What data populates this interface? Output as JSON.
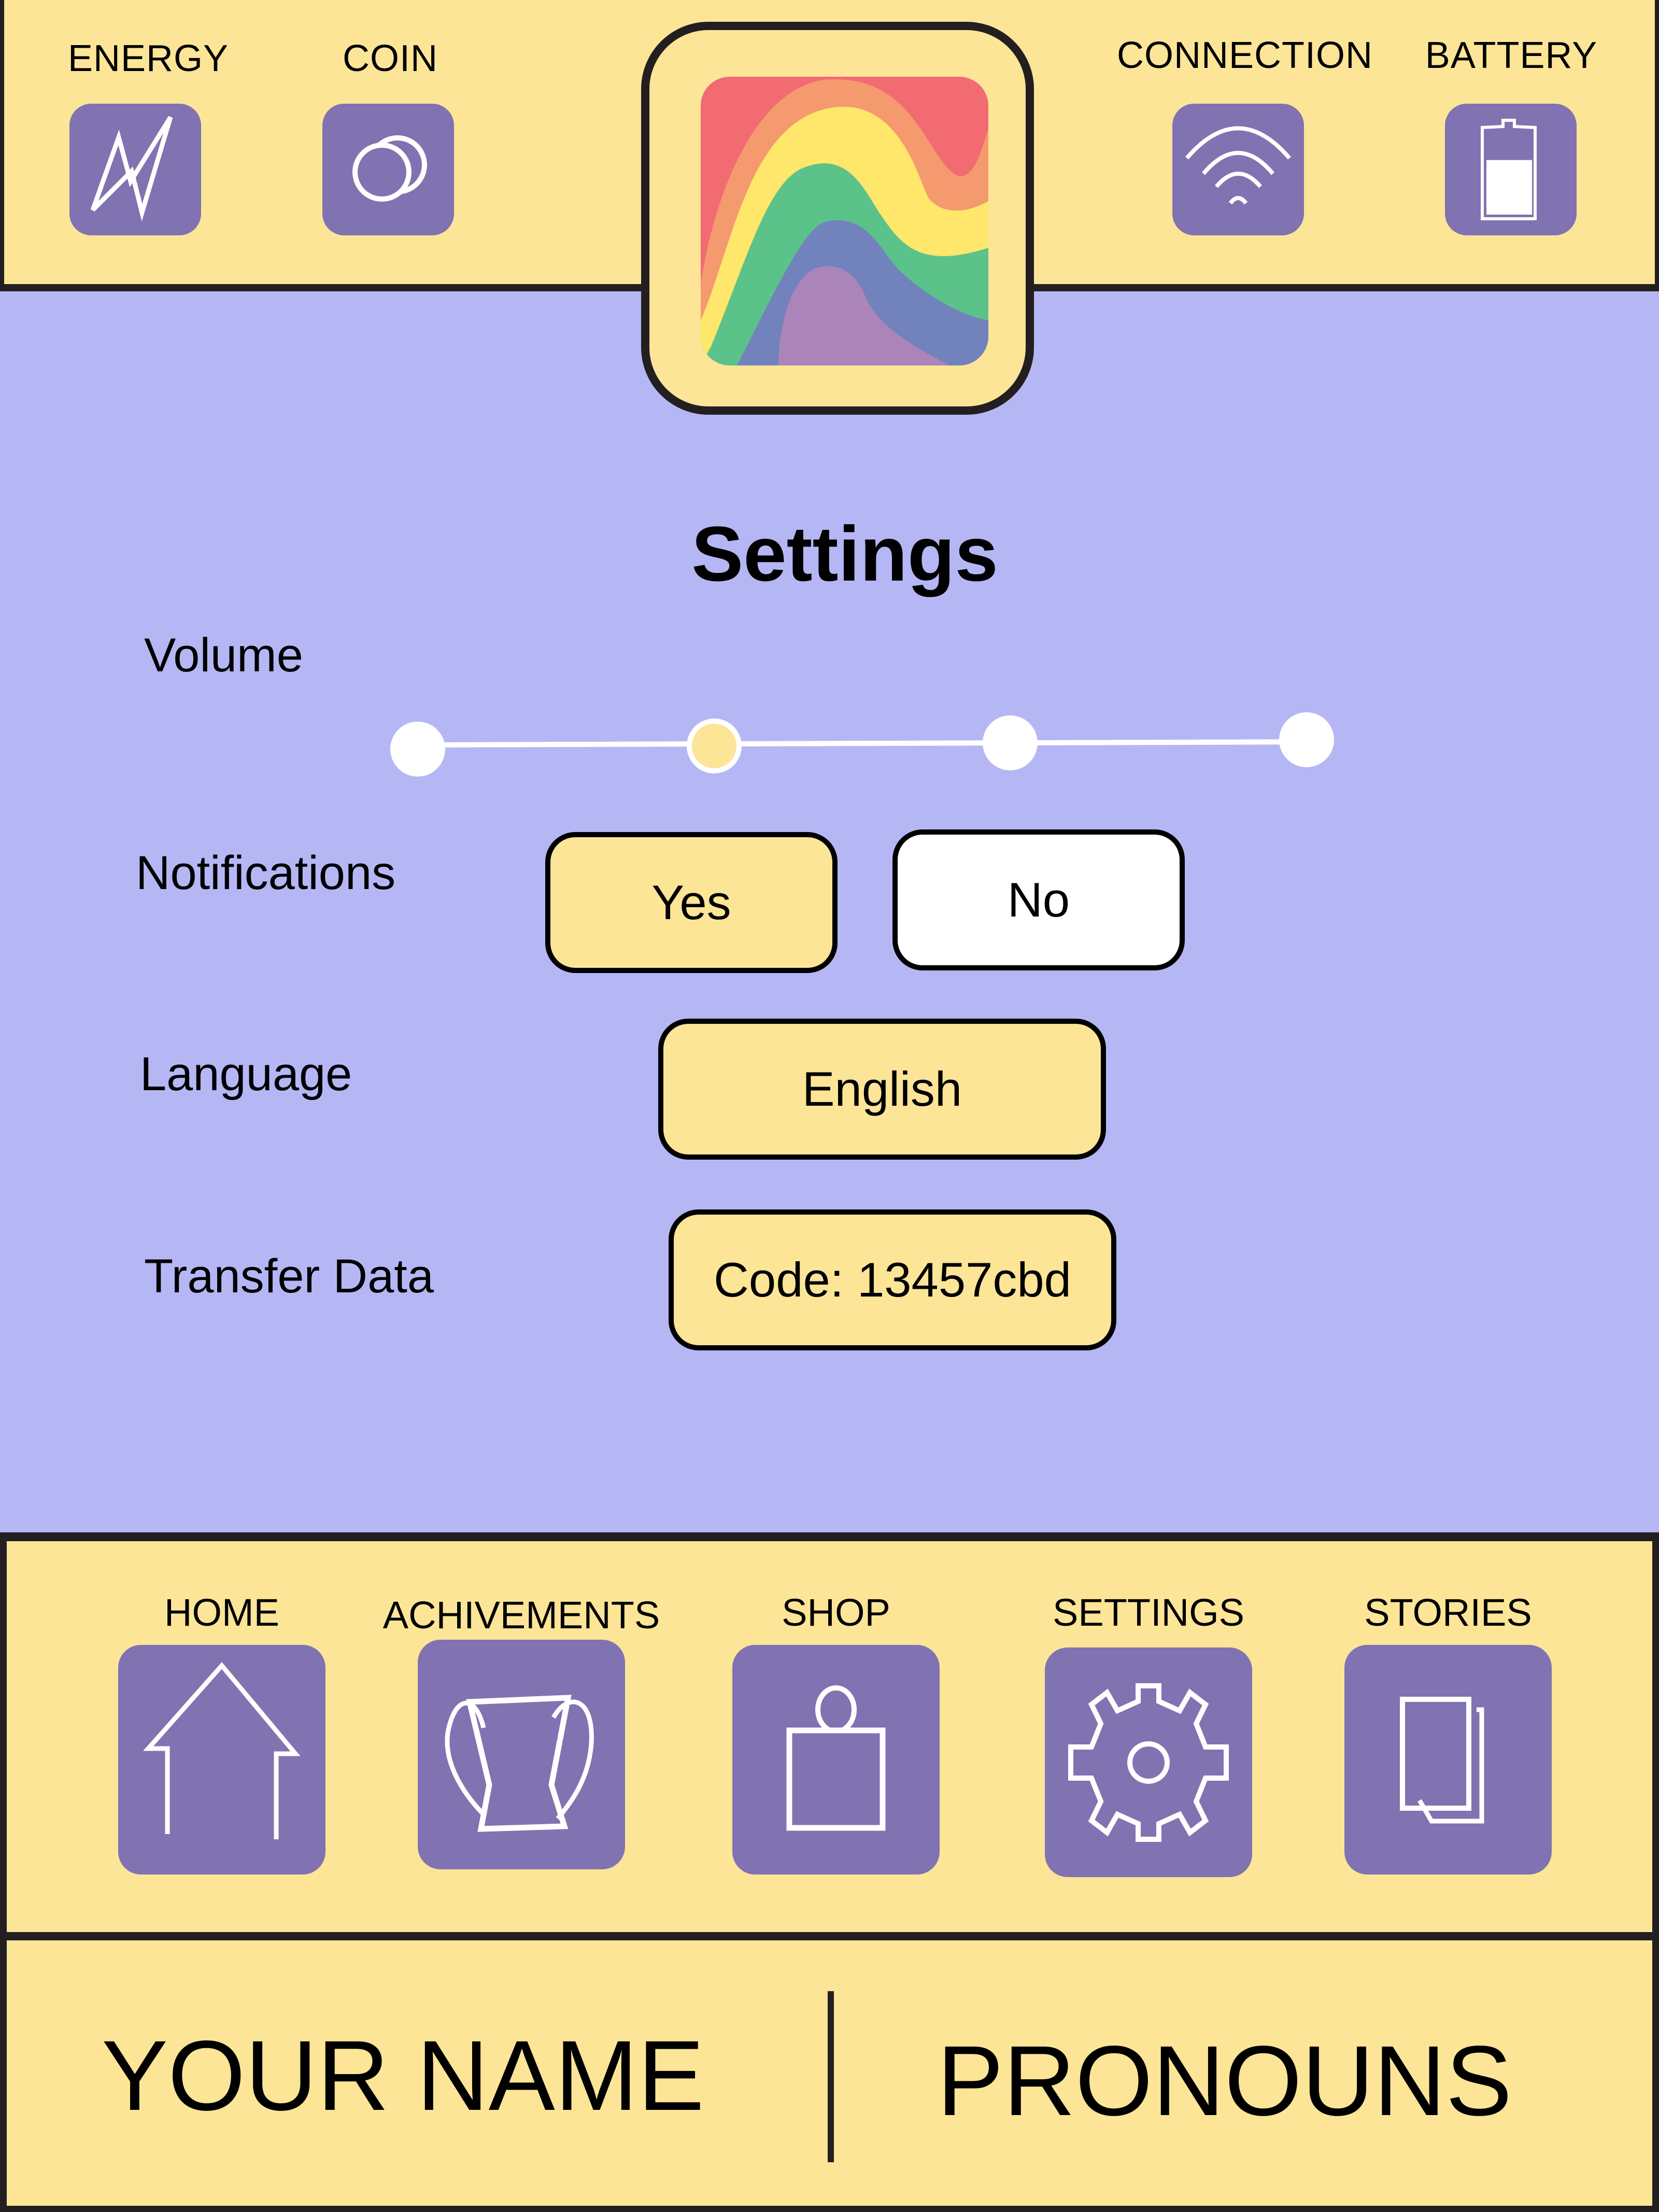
{
  "header": {
    "status_items": [
      {
        "label": "ENERGY",
        "icon": "lightning-bolt-icon"
      },
      {
        "label": "COIN",
        "icon": "coins-icon"
      },
      {
        "label": "CONNECTION",
        "icon": "wifi-icon"
      },
      {
        "label": "BATTERY",
        "icon": "battery-icon"
      }
    ],
    "battery_level_percent": 65,
    "logo": "rainbow-waves-logo"
  },
  "settings": {
    "title": "Settings",
    "volume": {
      "label": "Volume",
      "steps": 4,
      "selected_step": 2
    },
    "notifications": {
      "label": "Notifications",
      "options": [
        "Yes",
        "No"
      ],
      "selected": "Yes"
    },
    "language": {
      "label": "Language",
      "value": "English"
    },
    "transfer_data": {
      "label": "Transfer Data",
      "value": "Code: 13457cbd"
    }
  },
  "nav": {
    "items": [
      {
        "label": "HOME",
        "icon": "home-icon"
      },
      {
        "label": "ACHIVEMENTS",
        "icon": "trophy-icon"
      },
      {
        "label": "SHOP",
        "icon": "shopping-bag-icon"
      },
      {
        "label": "SETTINGS",
        "icon": "gear-icon"
      },
      {
        "label": "STORIES",
        "icon": "pages-icon"
      }
    ]
  },
  "profile": {
    "name": "YOUR NAME",
    "pronouns": "PRONOUNS"
  },
  "colors": {
    "panel_yellow": "#FCE597",
    "background_lavender": "#B5B7F5",
    "icon_purple": "#8172B1",
    "border": "#231F20",
    "rainbow": [
      "#F26B72",
      "#F59A6F",
      "#FEE76A",
      "#5BC28A",
      "#7282BC",
      "#AB84B9"
    ]
  }
}
